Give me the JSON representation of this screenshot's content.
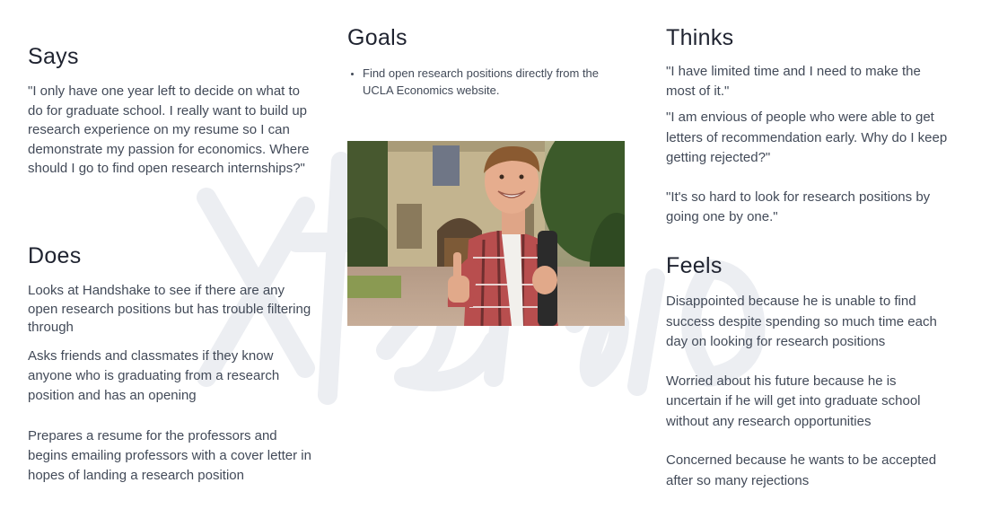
{
  "says": {
    "title": "Says",
    "quote": "\"I only have one year left to decide on what to do for graduate school. I really want to build up research experience on my resume so I can demonstrate my passion for economics. Where should I go to find open research internships?\""
  },
  "does": {
    "title": "Does",
    "items": [
      "Looks at Handshake to see if there are any open research positions but has trouble filtering through",
      "Asks friends and classmates if they know anyone who is graduating from a research position and has an opening",
      "Prepares a resume for the professors and begins emailing professors with a cover letter in hopes of landing a research position"
    ]
  },
  "goals": {
    "title": "Goals",
    "items": [
      "Find open research positions directly from the UCLA Economics website."
    ]
  },
  "thinks": {
    "title": "Thinks",
    "items": [
      "\"I have limited time and I need to make the most of it.\"",
      "\"I am envious of people who were able to get letters of recommendation early. Why do I keep getting rejected?\"",
      "\"It's so hard to look for research positions by going one by one.\""
    ]
  },
  "feels": {
    "title": "Feels",
    "items": [
      "Disappointed because he is unable to find success despite spending so much time each day on looking for research positions",
      "Worried about his future because he is uncertain if he will get into graduate school without any research opportunities",
      "Concerned because he wants to be accepted after so many rejections"
    ]
  },
  "photo": {
    "subject": "smiling-student-thumbs-up"
  },
  "watermark": {
    "text": "Xtensio"
  }
}
